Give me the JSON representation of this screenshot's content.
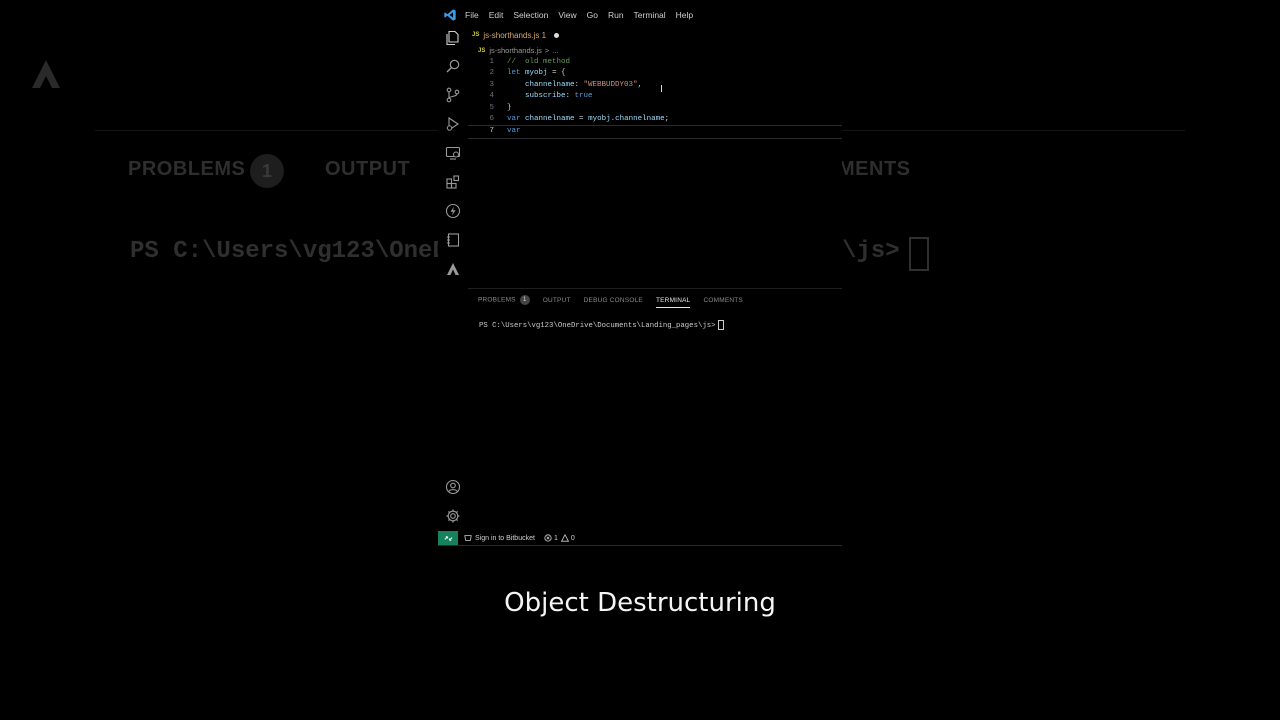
{
  "background_echo": {
    "panel_tabs": [
      "PROBLEMS",
      "OUTPUT",
      "MENTS"
    ],
    "problems_badge": "1",
    "terminal_left": "PS C:\\Users\\vg123\\OneD",
    "terminal_right": "\\js>"
  },
  "menu": [
    "File",
    "Edit",
    "Selection",
    "View",
    "Go",
    "Run",
    "Terminal",
    "Help"
  ],
  "activity_icons": [
    "explorer-icon",
    "search-icon",
    "source-control-icon",
    "run-debug-icon",
    "remote-explorer-icon",
    "extensions-icon",
    "lightning-icon",
    "notebook-icon",
    "atlassian-icon",
    "account-icon",
    "gear-icon"
  ],
  "tab": {
    "icon_text": "JS",
    "label": "js-shorthands.js 1"
  },
  "breadcrumb": {
    "icon_text": "JS",
    "file": "js-shorthands.js",
    "sep": ">",
    "rest": "..."
  },
  "editor": {
    "lines": [
      {
        "n": "1",
        "parts": [
          {
            "c": "cm",
            "t": "//  old method"
          }
        ]
      },
      {
        "n": "2",
        "parts": [
          {
            "c": "kw",
            "t": "let"
          },
          {
            "c": "pl",
            "t": " "
          },
          {
            "c": "vr",
            "t": "myobj"
          },
          {
            "c": "pl",
            "t": " = {"
          }
        ]
      },
      {
        "n": "3",
        "parts": [
          {
            "c": "pl",
            "t": "    "
          },
          {
            "c": "vr",
            "t": "channelname"
          },
          {
            "c": "pl",
            "t": ": "
          },
          {
            "c": "str",
            "t": "\"WEBBUDDY03\""
          },
          {
            "c": "pl",
            "t": ","
          }
        ]
      },
      {
        "n": "4",
        "parts": [
          {
            "c": "pl",
            "t": "    "
          },
          {
            "c": "vr",
            "t": "subscribe"
          },
          {
            "c": "pl",
            "t": ": "
          },
          {
            "c": "bool",
            "t": "true"
          }
        ]
      },
      {
        "n": "5",
        "parts": [
          {
            "c": "pl",
            "t": "}"
          }
        ]
      },
      {
        "n": "6",
        "parts": [
          {
            "c": "kw",
            "t": "var"
          },
          {
            "c": "pl",
            "t": " "
          },
          {
            "c": "vr",
            "t": "channelname"
          },
          {
            "c": "pl",
            "t": " = "
          },
          {
            "c": "vr",
            "t": "myobj"
          },
          {
            "c": "pl",
            "t": "."
          },
          {
            "c": "vr",
            "t": "channelname"
          },
          {
            "c": "pl",
            "t": ";"
          }
        ]
      },
      {
        "n": "7",
        "parts": [
          {
            "c": "kw",
            "t": "var"
          }
        ]
      }
    ],
    "active_line": "7"
  },
  "panel": {
    "tabs": [
      "PROBLEMS",
      "OUTPUT",
      "DEBUG CONSOLE",
      "TERMINAL",
      "COMMENTS"
    ],
    "active_tab": "TERMINAL",
    "problems_count": "1",
    "terminal_prompt": "PS C:\\Users\\vg123\\OneDrive\\Documents\\Landing_pages\\js>"
  },
  "statusbar": {
    "bitbucket": "Sign in to Bitbucket",
    "errors": "1",
    "warnings": "0"
  },
  "caption": "Object Destructuring",
  "colors": {
    "accent_green": "#16825d",
    "tab_modified": "#d7a86e",
    "keyword": "#569cd6",
    "string": "#ce9178",
    "comment": "#6a9955"
  }
}
